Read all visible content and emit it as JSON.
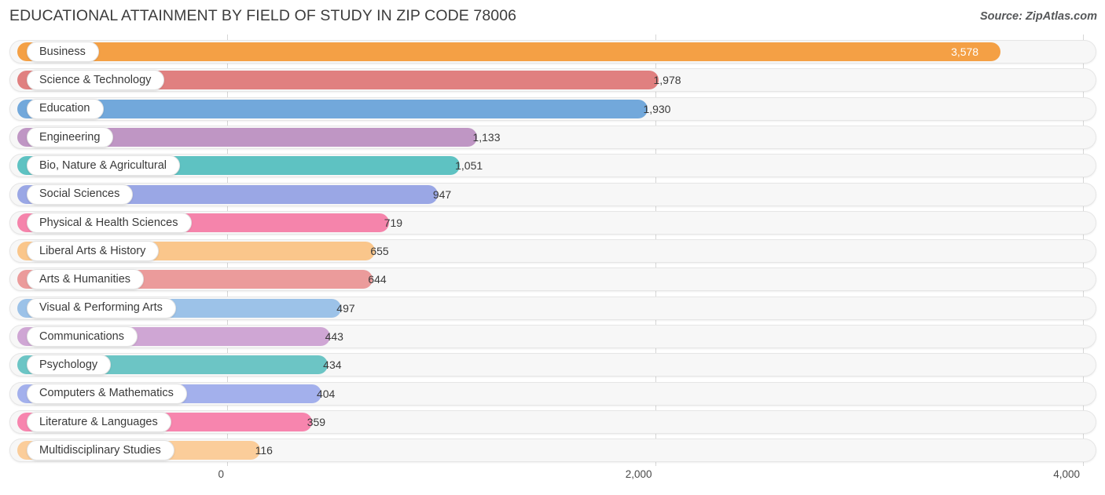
{
  "header": {
    "title": "EDUCATIONAL ATTAINMENT BY FIELD OF STUDY IN ZIP CODE 78006",
    "source": "Source: ZipAtlas.com"
  },
  "chart_data": {
    "type": "bar",
    "orientation": "horizontal",
    "title": "EDUCATIONAL ATTAINMENT BY FIELD OF STUDY IN ZIP CODE 78006",
    "xlabel": "",
    "ylabel": "",
    "xlim": [
      0,
      4000
    ],
    "xticks": [
      0,
      2000,
      4000
    ],
    "xtick_labels": [
      "0",
      "2,000",
      "4,000"
    ],
    "grid": true,
    "legend": false,
    "categories": [
      "Business",
      "Science & Technology",
      "Education",
      "Engineering",
      "Bio, Nature & Agricultural",
      "Social Sciences",
      "Physical & Health Sciences",
      "Liberal Arts & History",
      "Arts & Humanities",
      "Visual & Performing Arts",
      "Communications",
      "Psychology",
      "Computers & Mathematics",
      "Literature & Languages",
      "Multidisciplinary Studies"
    ],
    "values": [
      3578,
      1978,
      1930,
      1133,
      1051,
      947,
      719,
      655,
      644,
      497,
      443,
      434,
      404,
      359,
      116
    ],
    "value_labels": [
      "3,578",
      "1,978",
      "1,930",
      "1,133",
      "1,051",
      "947",
      "719",
      "655",
      "644",
      "497",
      "443",
      "434",
      "404",
      "359",
      "116"
    ],
    "colors": [
      "#f4a045",
      "#e08080",
      "#72a8db",
      "#bf96c4",
      "#5ec2c2",
      "#9aa7e5",
      "#f584ab",
      "#fac68b",
      "#eb9b9b",
      "#9cc2e8",
      "#cfa6d4",
      "#6cc5c5",
      "#a3b0ec",
      "#f785ae",
      "#fbcd9a"
    ],
    "bars": [
      {
        "label": "Business",
        "value": 3578,
        "display": "3,578",
        "color": "#f4a045",
        "label_inside": true
      },
      {
        "label": "Science & Technology",
        "value": 1978,
        "display": "1,978",
        "color": "#e08080",
        "label_inside": false
      },
      {
        "label": "Education",
        "value": 1930,
        "display": "1,930",
        "color": "#72a8db",
        "label_inside": false
      },
      {
        "label": "Engineering",
        "value": 1133,
        "display": "1,133",
        "color": "#bf96c4",
        "label_inside": false
      },
      {
        "label": "Bio, Nature & Agricultural",
        "value": 1051,
        "display": "1,051",
        "color": "#5ec2c2",
        "label_inside": false
      },
      {
        "label": "Social Sciences",
        "value": 947,
        "display": "947",
        "color": "#9aa7e5",
        "label_inside": false
      },
      {
        "label": "Physical & Health Sciences",
        "value": 719,
        "display": "719",
        "color": "#f584ab",
        "label_inside": false
      },
      {
        "label": "Liberal Arts & History",
        "value": 655,
        "display": "655",
        "color": "#fac68b",
        "label_inside": false
      },
      {
        "label": "Arts & Humanities",
        "value": 644,
        "display": "644",
        "color": "#eb9b9b",
        "label_inside": false
      },
      {
        "label": "Visual & Performing Arts",
        "value": 497,
        "display": "497",
        "color": "#9cc2e8",
        "label_inside": false
      },
      {
        "label": "Communications",
        "value": 443,
        "display": "443",
        "color": "#cfa6d4",
        "label_inside": false
      },
      {
        "label": "Psychology",
        "value": 434,
        "display": "434",
        "color": "#6cc5c5",
        "label_inside": false
      },
      {
        "label": "Computers & Mathematics",
        "value": 404,
        "display": "404",
        "color": "#a3b0ec",
        "label_inside": false
      },
      {
        "label": "Literature & Languages",
        "value": 359,
        "display": "359",
        "color": "#f785ae",
        "label_inside": false
      },
      {
        "label": "Multidisciplinary Studies",
        "value": 116,
        "display": "116",
        "color": "#fbcd9a",
        "label_inside": false
      }
    ]
  }
}
